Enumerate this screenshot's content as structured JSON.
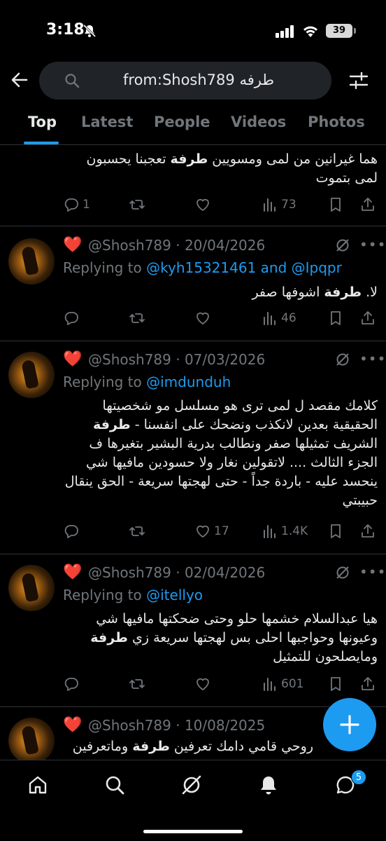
{
  "status_bar": {
    "time": "3:18",
    "battery": "39"
  },
  "search": {
    "query": "from:Shosh789 طرفه"
  },
  "tabs": [
    {
      "label": "Top",
      "active": true
    },
    {
      "label": "Latest"
    },
    {
      "label": "People"
    },
    {
      "label": "Videos"
    },
    {
      "label": "Photos"
    }
  ],
  "tweets": [
    {
      "text_parts": [
        {
          "t": "هما غيرانين من لمى ومسويين "
        },
        {
          "t": "طرفة",
          "bold": true
        },
        {
          "t": " تعجبنا يحسبون لمى بتموت"
        }
      ],
      "actions": {
        "replies": "1",
        "reposts": "",
        "likes": "",
        "views": "73"
      }
    },
    {
      "emoji": "❤️",
      "handle_date": "@Shosh789 · 20/04/2026",
      "reply_prefix": "Replying to ",
      "reply_to": "@kyh15321461 and @Ipqpr",
      "text_parts": [
        {
          "t": "لا.  "
        },
        {
          "t": "طرفة",
          "bold": true
        },
        {
          "t": " اشوفها صفر"
        }
      ],
      "actions": {
        "replies": "",
        "reposts": "",
        "likes": "",
        "views": "46"
      }
    },
    {
      "emoji": "❤️",
      "handle_date": "@Shosh789 · 07/03/2026",
      "reply_prefix": "Replying to ",
      "reply_to": "@imdunduh",
      "text_parts": [
        {
          "t": "كلامك مقصد ل لمى ترى هو مسلسل مو شخصيتها الحقيقية بعدين لانكذب ونضحك على انفسنا - "
        },
        {
          "t": "طرفة",
          "bold": true
        },
        {
          "t": " الشريف تمثيلها صفر ونطالب بدرية البشير بتغيرها ف الجزء الثالث .... لاتقولين نغار ولا حسودين مافيها شي ينحسد عليه - باردة جداً - حتى لهجتها سريعة - الحق ينقال حبيبتي"
        }
      ],
      "actions": {
        "replies": "",
        "reposts": "",
        "likes": "17",
        "views": "1.4K"
      }
    },
    {
      "emoji": "❤️",
      "handle_date": "@Shosh789 · 02/04/2026",
      "reply_prefix": "Replying to ",
      "reply_to": "@itellyo",
      "text_parts": [
        {
          "t": "هيا عبدالسلام خشمها حلو وحتى ضحكتها مافيها شي وعيونها وحواجبها احلى بس لهجتها سريعة زي "
        },
        {
          "t": "طرفة",
          "bold": true
        },
        {
          "t": " ومايصلحون للتمثيل"
        }
      ],
      "actions": {
        "replies": "",
        "reposts": "",
        "likes": "",
        "views": "601"
      }
    },
    {
      "emoji": "❤️",
      "handle_date": "@Shosh789 · 10/08/2025",
      "text_parts": [
        {
          "t": "روحي قامي دامك تعرفين "
        },
        {
          "t": "طرفة",
          "bold": true
        },
        {
          "t": " وماتعرفين"
        }
      ]
    }
  ],
  "nav": {
    "messages_badge": "5"
  },
  "colors": {
    "accent": "#1d9bf0",
    "background": "#000000",
    "secondary_text": "#71767b"
  },
  "icons": {
    "actions": [
      "reply-icon",
      "repost-icon",
      "like-icon",
      "views-icon",
      "bookmark-icon",
      "share-icon"
    ],
    "nav": [
      "home-icon",
      "search-icon",
      "grok-icon",
      "notifications-icon",
      "messages-icon"
    ]
  }
}
